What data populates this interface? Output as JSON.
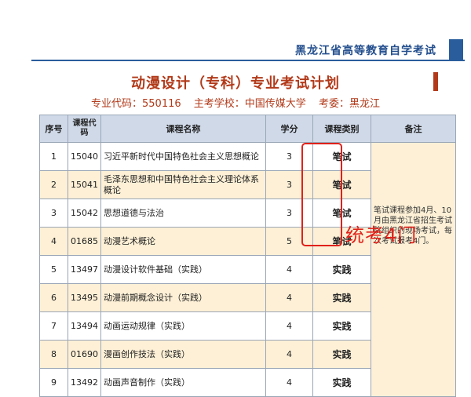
{
  "header": {
    "organization": "黑龙江省高等教育自学考试",
    "plan_title": "动漫设计（专科）专业考试计划",
    "major_code": "专业代码：550116",
    "school": "主考学校：中国传媒大学",
    "committee": "考委：黑龙江"
  },
  "table": {
    "columns": [
      "序号",
      "课程代码",
      "课程名称",
      "学分",
      "课程类别",
      "备注"
    ],
    "rows": [
      {
        "no": "1",
        "code": "15040",
        "name": "习近平新时代中国特色社会主义思想概论",
        "credit": "3",
        "type": "笔试"
      },
      {
        "no": "2",
        "code": "15041",
        "name": "毛泽东思想和中国特色社会主义理论体系概论",
        "credit": "3",
        "type": "笔试"
      },
      {
        "no": "3",
        "code": "15042",
        "name": "思想道德与法治",
        "credit": "3",
        "type": "笔试"
      },
      {
        "no": "4",
        "code": "01685",
        "name": "动漫艺术概论",
        "credit": "5",
        "type": "笔试"
      },
      {
        "no": "5",
        "code": "13497",
        "name": "动漫设计软件基础（实践）",
        "credit": "4",
        "type": "实践"
      },
      {
        "no": "6",
        "code": "13495",
        "name": "动漫前期概念设计（实践）",
        "credit": "4",
        "type": "实践"
      },
      {
        "no": "7",
        "code": "13494",
        "name": "动画运动规律（实践）",
        "credit": "4",
        "type": "实践"
      },
      {
        "no": "8",
        "code": "01690",
        "name": "漫画创作技法（实践）",
        "credit": "4",
        "type": "实践"
      },
      {
        "no": "9",
        "code": "13492",
        "name": "动画声音制作（实践）",
        "credit": "4",
        "type": "实践"
      }
    ],
    "note": "笔试课程参加4月、10月由黑龙江省招生考试院组织的现场考试，每次考试报考4门。"
  },
  "annotation": {
    "text": "统考4门",
    "color": "#e0211a"
  },
  "colors": {
    "title_red": "#b23a1a",
    "header_blue": "#2a5d9c",
    "row_tint": "#fdf0d6",
    "table_header": "#cfd9e8"
  }
}
